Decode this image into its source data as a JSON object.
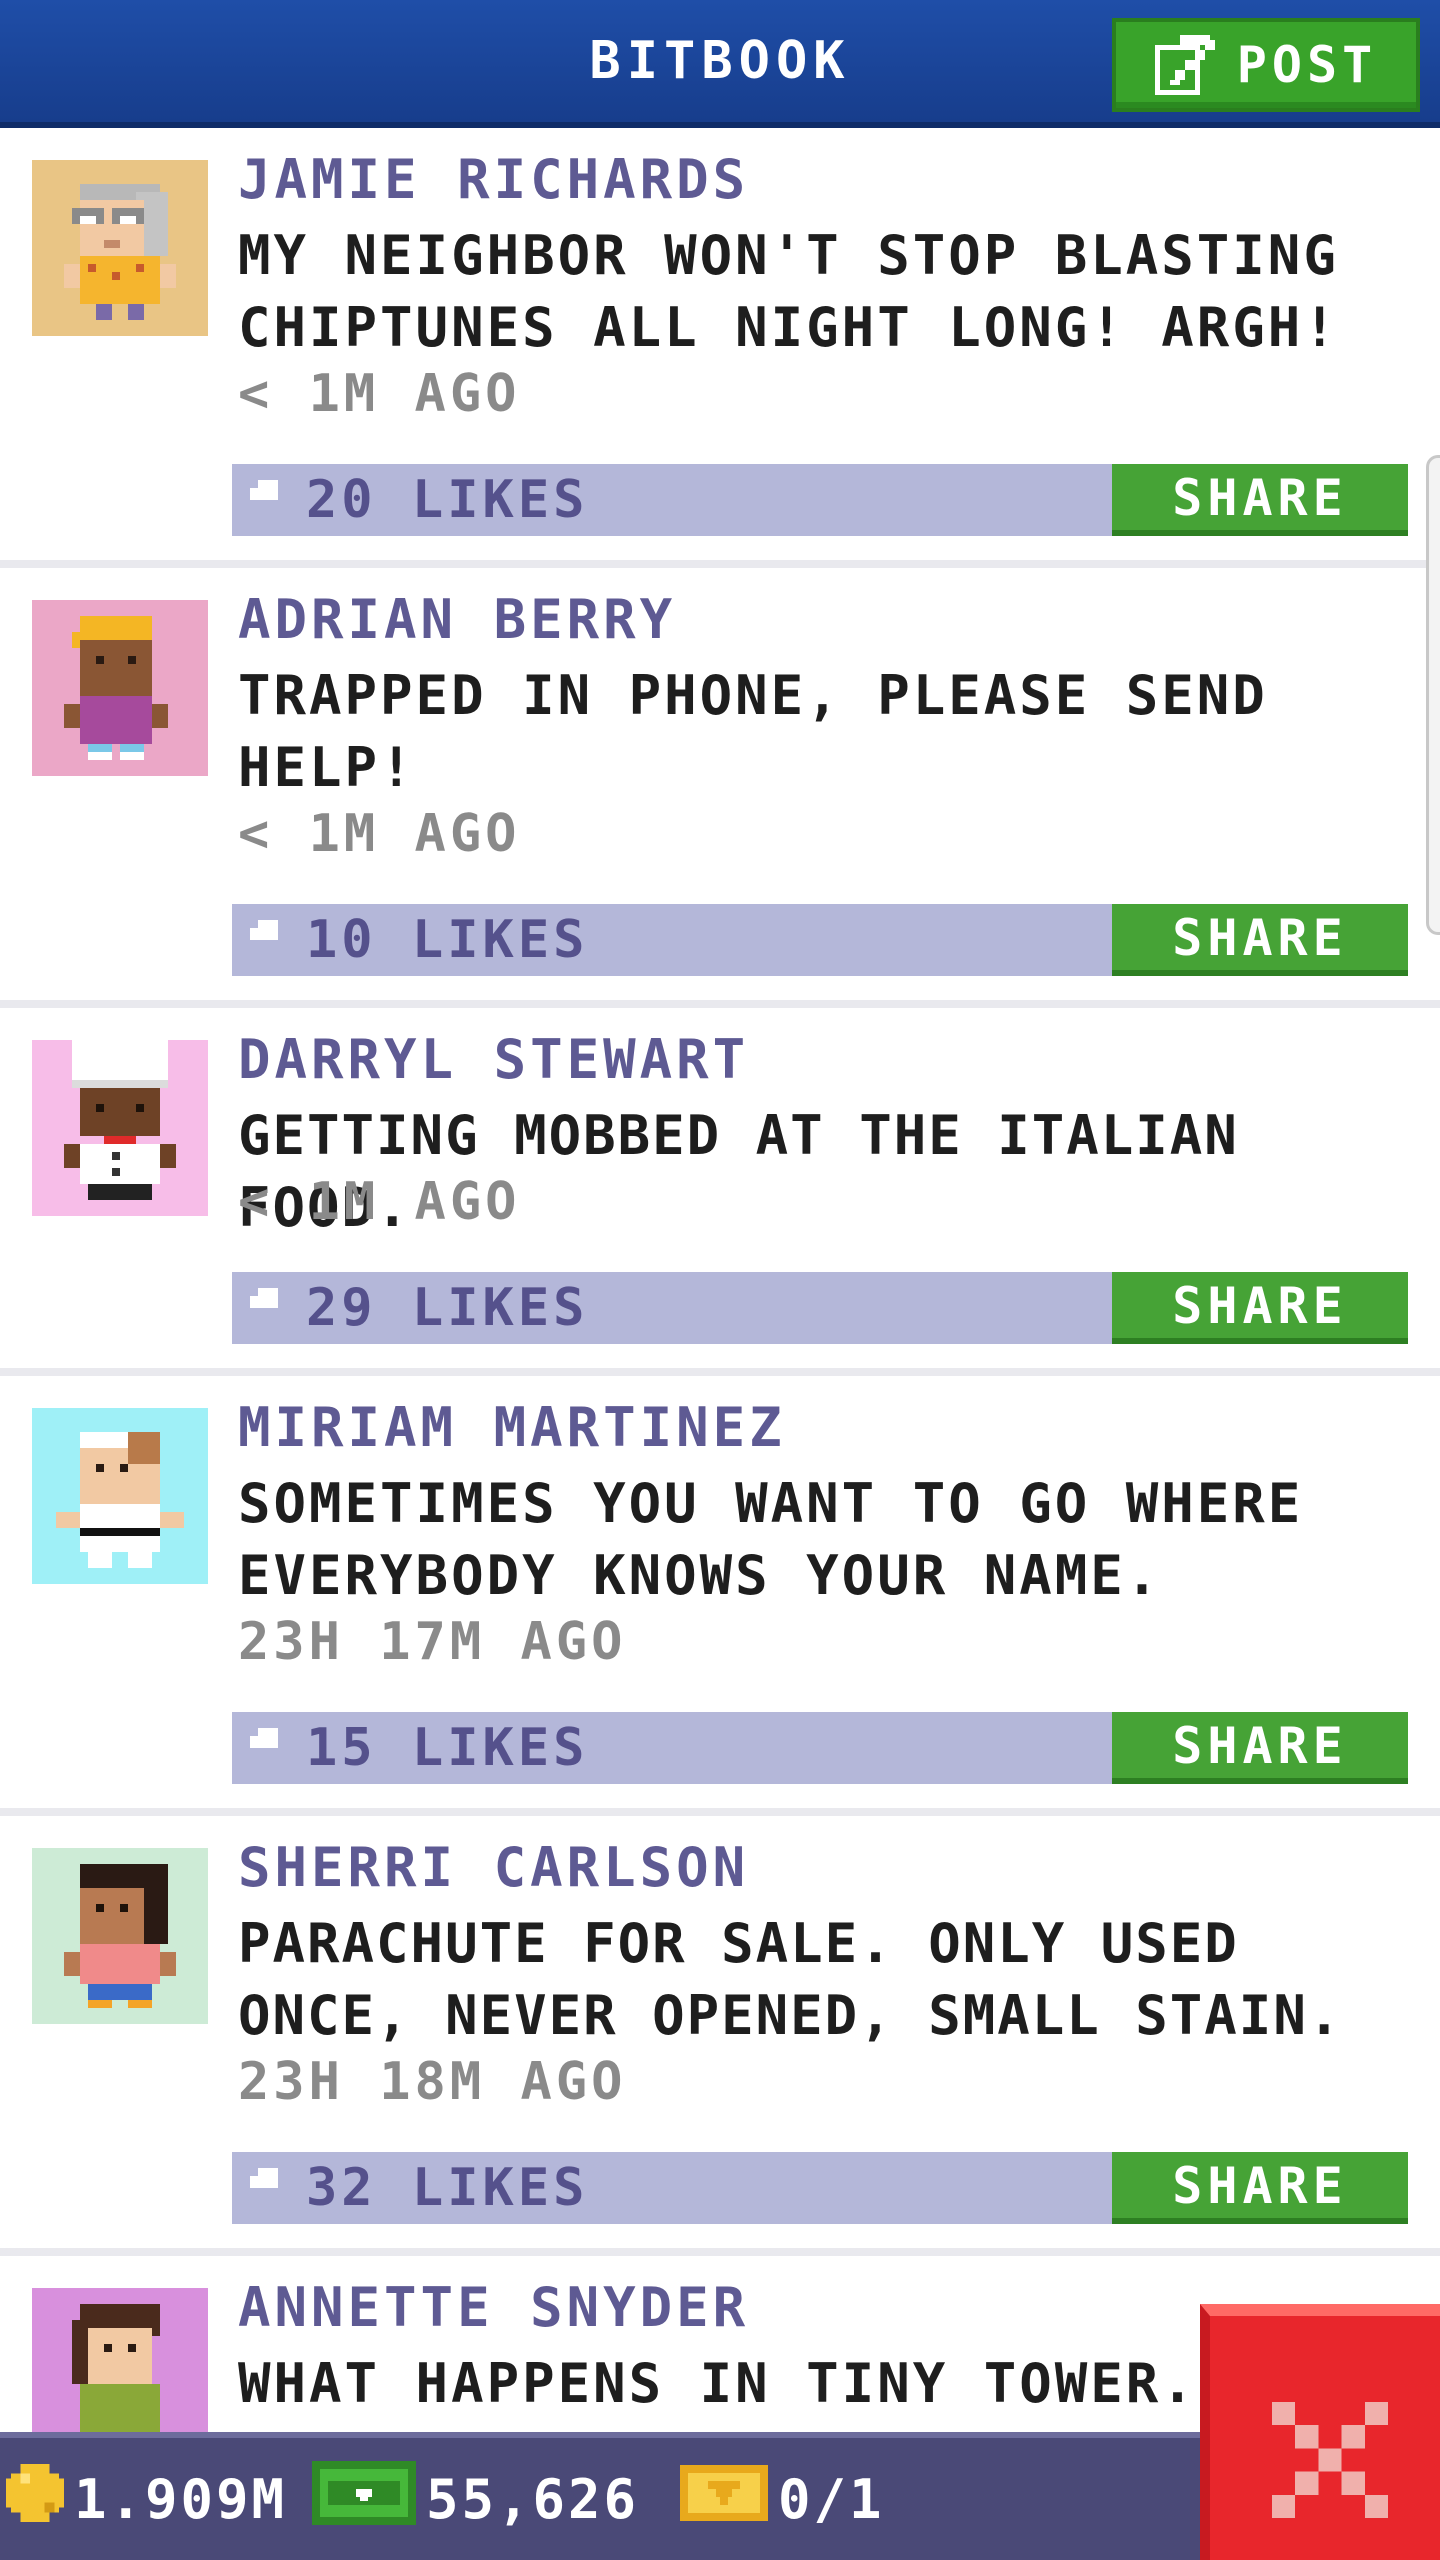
{
  "header": {
    "title": "BITBOOK",
    "post_label": "POST"
  },
  "colors": {
    "header_blue": "#1f4ea8",
    "name_purple": "#5e5a93",
    "likes_bar": "#b4b7d9",
    "share_green": "#46a336",
    "close_red": "#e8262c",
    "bottom_bar": "#4a4977"
  },
  "posts": [
    {
      "name": "JAMIE RICHARDS",
      "text": "MY NEIGHBOR WON'T STOP BLASTING CHIPTUNES ALL NIGHT LONG! ARGH!",
      "time": "< 1M AGO",
      "likes": "20 LIKES",
      "share_label": "SHARE",
      "avatar_bg": "#e9c585",
      "avatar_icon": "elderly-woman-avatar-icon"
    },
    {
      "name": "ADRIAN BERRY",
      "text": "TRAPPED IN PHONE, PLEASE SEND HELP!",
      "time": "< 1M AGO",
      "likes": "10 LIKES",
      "share_label": "SHARE",
      "avatar_bg": "#eba7c7",
      "avatar_icon": "boy-avatar-icon"
    },
    {
      "name": "DARRYL STEWART",
      "text": "GETTING MOBBED AT THE ITALIAN FOOD.",
      "time": "< 1M AGO",
      "likes": "29 LIKES",
      "share_label": "SHARE",
      "avatar_bg": "#f7bde8",
      "avatar_icon": "chef-avatar-icon"
    },
    {
      "name": "MIRIAM MARTINEZ",
      "text": "SOMETIMES YOU WANT TO GO WHERE EVERYBODY KNOWS YOUR NAME.",
      "time": "23H 17M AGO",
      "likes": "15 LIKES",
      "share_label": "SHARE",
      "avatar_bg": "#9ff0f7",
      "avatar_icon": "karate-avatar-icon"
    },
    {
      "name": "SHERRI CARLSON",
      "text": "PARACHUTE FOR SALE. ONLY USED ONCE, NEVER OPENED, SMALL STAIN.",
      "time": "23H 18M AGO",
      "likes": "32 LIKES",
      "share_label": "SHARE",
      "avatar_bg": "#cdebd6",
      "avatar_icon": "woman-avatar-icon"
    },
    {
      "name": "ANNETTE SNYDER",
      "text": "WHAT HAPPENS IN TINY TOWER...",
      "avatar_bg": "#d890dd",
      "avatar_icon": "woman-green-shirt-avatar-icon"
    }
  ],
  "bottom_bar": {
    "coins": "1.909M",
    "bux": "55,626",
    "tickets": "0/1"
  }
}
